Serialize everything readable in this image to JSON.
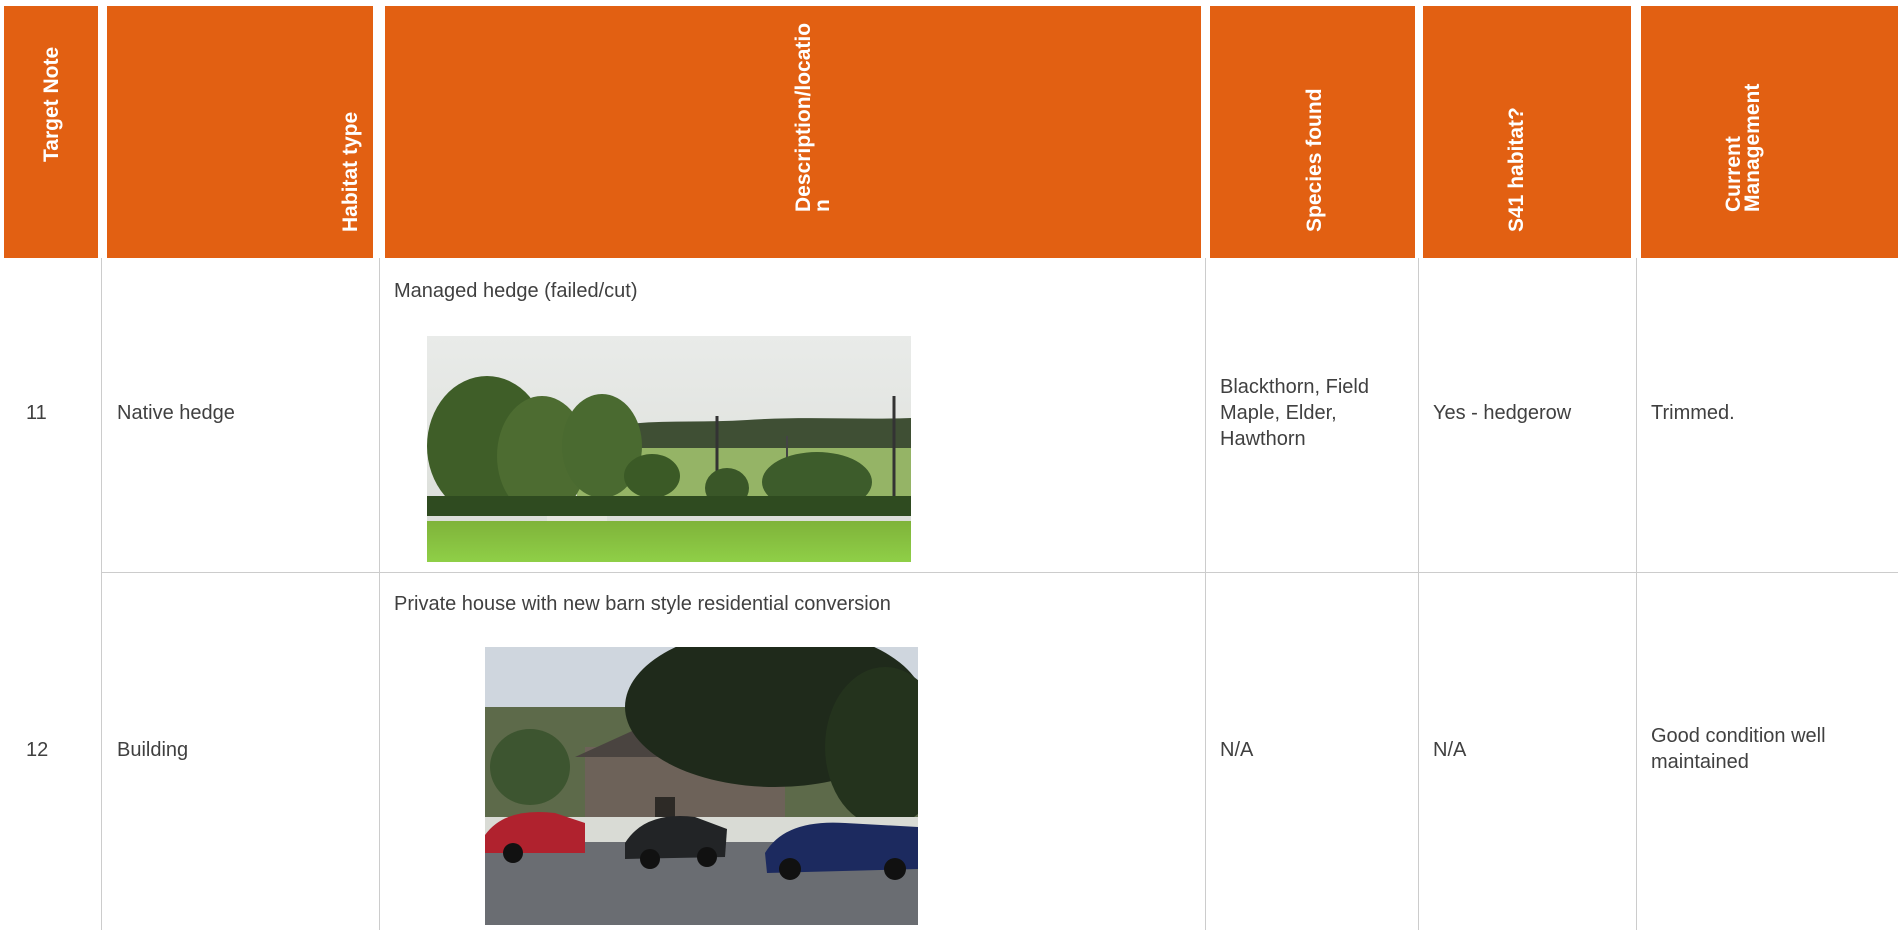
{
  "table": {
    "headers": [
      {
        "label": "Target Note"
      },
      {
        "label": "Habitat type"
      },
      {
        "label": "Description/locatio\nn"
      },
      {
        "label": "Species found"
      },
      {
        "label": "S41 habitat?"
      },
      {
        "label": "Current\nManagement"
      }
    ],
    "rows": [
      {
        "target_note": "11",
        "habitat_type": "Native hedge",
        "description": "Managed hedge (failed/cut)",
        "photo_icon": "hedgerow-field-photo",
        "species_found": "Blackthorn, Field Maple, Elder, Hawthorn",
        "s41_habitat": "Yes - hedgerow",
        "current_management": "Trimmed."
      },
      {
        "target_note": "12",
        "habitat_type": "Building",
        "description": "Private house with new barn style residential conversion",
        "photo_icon": "house-with-cars-photo",
        "species_found": "N/A",
        "s41_habitat": "N/A",
        "current_management": "Good condition well maintained"
      }
    ]
  },
  "colors": {
    "header_bg": "#e26012",
    "header_text": "#ffffff",
    "grid": "#cccccc",
    "body_text": "#404040"
  }
}
